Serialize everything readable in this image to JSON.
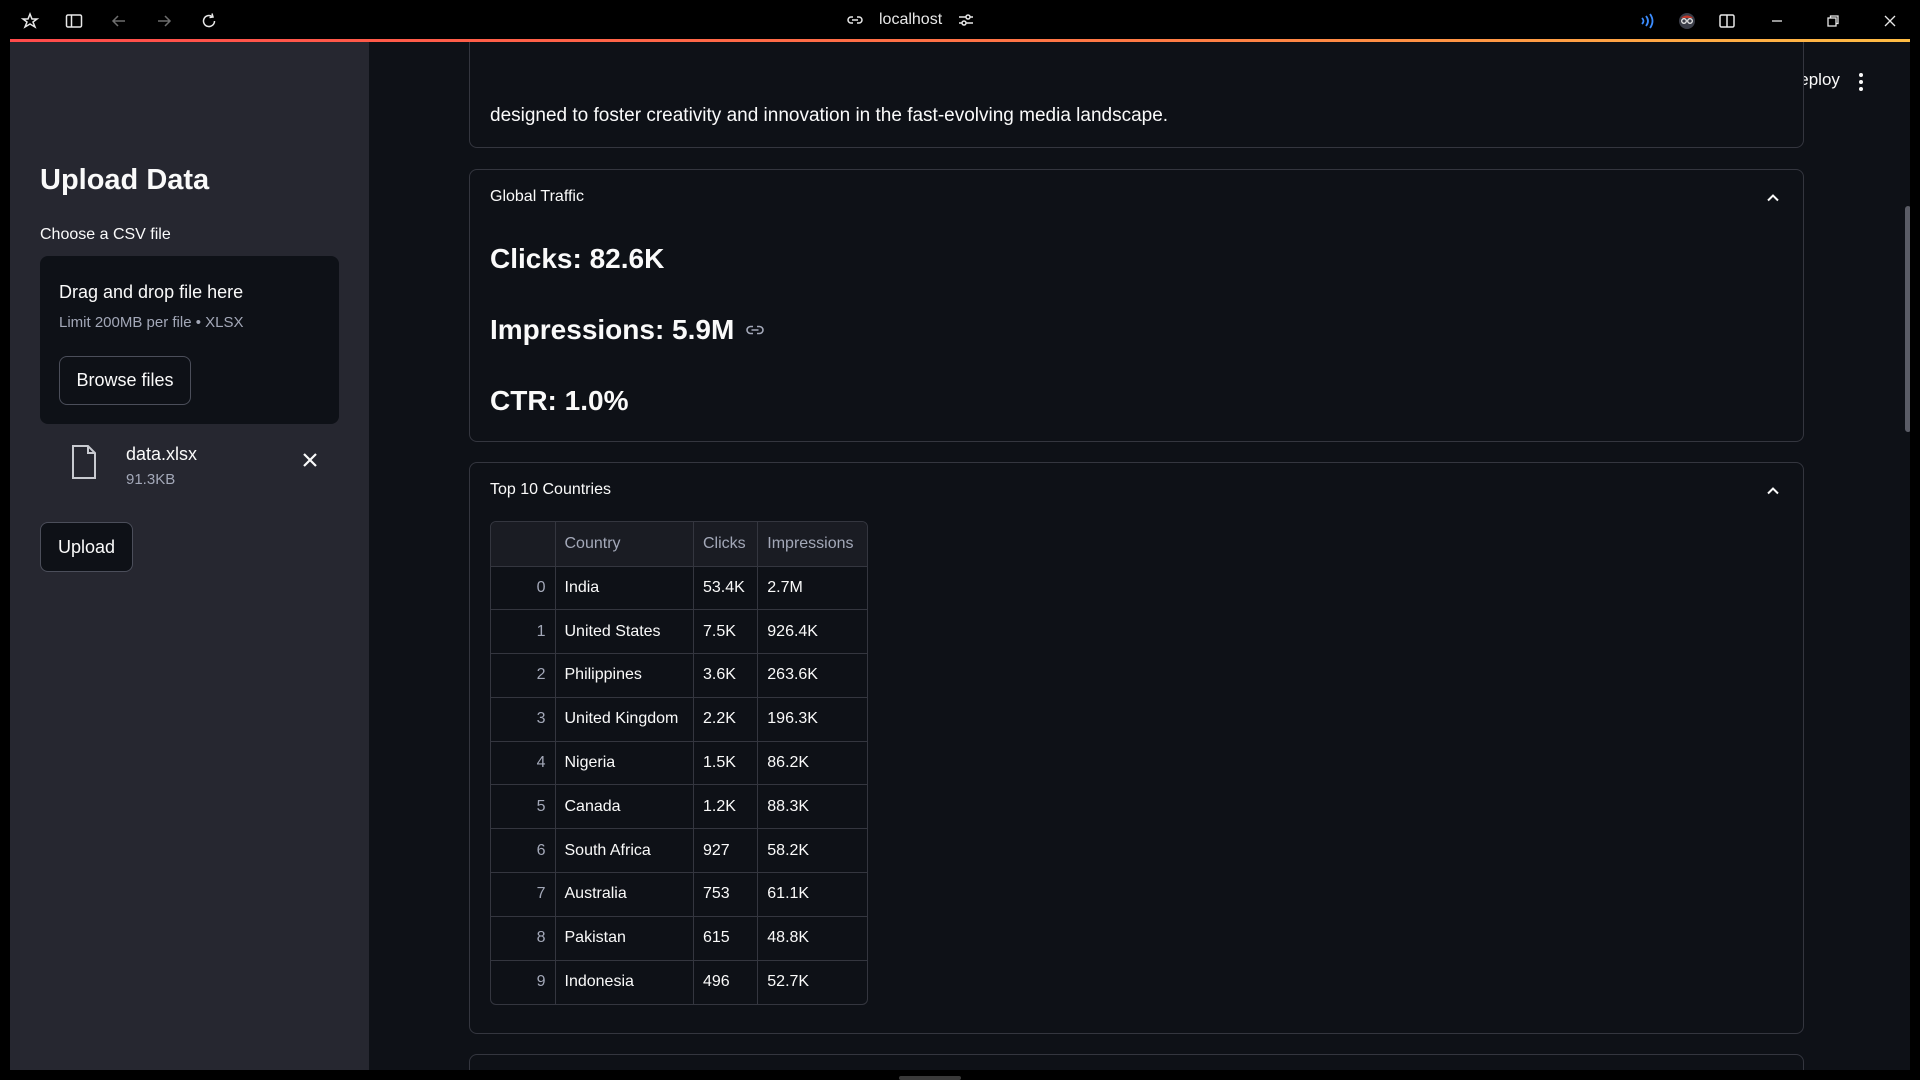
{
  "browser": {
    "url": "localhost"
  },
  "header": {
    "deploy_label": "Deploy"
  },
  "sidebar": {
    "title": "Upload Data",
    "uploader_label": "Choose a CSV file",
    "dropzone_title": "Drag and drop file here",
    "dropzone_limit": "Limit 200MB per file • XLSX",
    "browse_label": "Browse files",
    "file": {
      "name": "data.xlsx",
      "size": "91.3KB"
    },
    "upload_label": "Upload"
  },
  "main": {
    "cut_off_text": "designed to foster creativity and innovation in the fast-evolving media landscape.",
    "global_traffic": {
      "header": "Global Traffic",
      "clicks": "Clicks: 82.6K",
      "impressions": "Impressions: 5.9M",
      "ctr": "CTR: 1.0%"
    },
    "top_countries": {
      "header": "Top 10 Countries",
      "columns": [
        "",
        "Country",
        "Clicks",
        "Impressions"
      ],
      "rows": [
        [
          "0",
          "India",
          "53.4K",
          "2.7M"
        ],
        [
          "1",
          "United States",
          "7.5K",
          "926.4K"
        ],
        [
          "2",
          "Philippines",
          "3.6K",
          "263.6K"
        ],
        [
          "3",
          "United Kingdom",
          "2.2K",
          "196.3K"
        ],
        [
          "4",
          "Nigeria",
          "1.5K",
          "86.2K"
        ],
        [
          "5",
          "Canada",
          "1.2K",
          "88.3K"
        ],
        [
          "6",
          "South Africa",
          "927",
          "58.2K"
        ],
        [
          "7",
          "Australia",
          "753",
          "61.1K"
        ],
        [
          "8",
          "Pakistan",
          "615",
          "48.8K"
        ],
        [
          "9",
          "Indonesia",
          "496",
          "52.7K"
        ]
      ]
    }
  },
  "colors": {
    "app_bg": "#0e1117",
    "sidebar_bg": "#262730",
    "accent": "#ff4b4b",
    "border": "#34363f"
  }
}
